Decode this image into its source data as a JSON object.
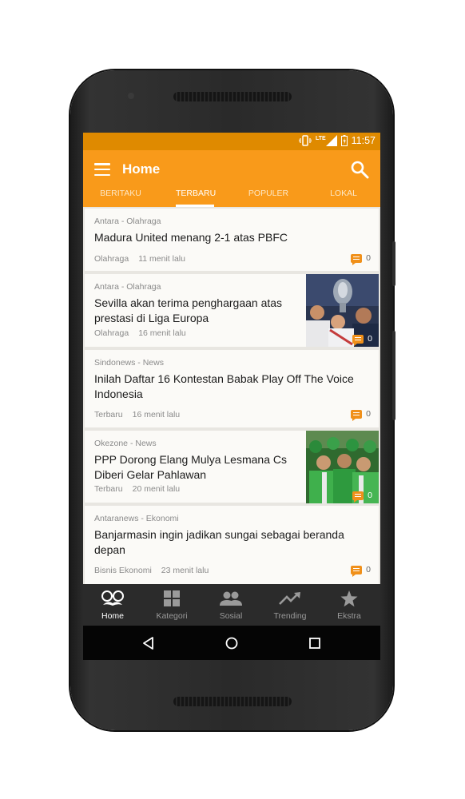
{
  "status_bar": {
    "time": "11:57",
    "network": "LTE"
  },
  "app_bar": {
    "title": "Home"
  },
  "tabs": [
    {
      "label": "BERITAKU",
      "active": false
    },
    {
      "label": "TERBARU",
      "active": true
    },
    {
      "label": "POPULER",
      "active": false
    },
    {
      "label": "LOKAL",
      "active": false
    }
  ],
  "articles": [
    {
      "source": "Antara - Olahraga",
      "title": "Madura United menang 2-1 atas PBFC",
      "category": "Olahraga",
      "time": "11 menit lalu",
      "comments": "0",
      "has_image": false
    },
    {
      "source": "Antara - Olahraga",
      "title": "Sevilla akan terima penghargaan atas prestasi di Liga Europa",
      "category": "Olahraga",
      "time": "16 menit lalu",
      "comments": "0",
      "has_image": true
    },
    {
      "source": "Sindonews - News",
      "title": "Inilah Daftar 16 Kontestan Babak Play Off The Voice Indonesia",
      "category": "Terbaru",
      "time": "16 menit lalu",
      "comments": "0",
      "has_image": false
    },
    {
      "source": "Okezone - News",
      "title": "PPP Dorong Elang Mulya Lesmana Cs Diberi Gelar Pahlawan",
      "category": "Terbaru",
      "time": "20 menit lalu",
      "comments": "0",
      "has_image": true
    },
    {
      "source": "Antaranews - Ekonomi",
      "title": "Banjarmasin ingin jadikan sungai sebagai beranda depan",
      "category": "Bisnis Ekonomi",
      "time": "23 menit lalu",
      "comments": "0",
      "has_image": false
    }
  ],
  "bottom_nav": [
    {
      "label": "Home",
      "icon": "glasses-mustache-icon",
      "active": true
    },
    {
      "label": "Kategori",
      "icon": "grid-icon",
      "active": false
    },
    {
      "label": "Sosial",
      "icon": "people-icon",
      "active": false
    },
    {
      "label": "Trending",
      "icon": "trending-up-icon",
      "active": false
    },
    {
      "label": "Ekstra",
      "icon": "star-icon",
      "active": false
    }
  ],
  "colors": {
    "accent": "#f99a1a",
    "status_bar": "#df8a00",
    "comment_icon": "#f0901a",
    "nav_bg": "#2b2b2b"
  }
}
